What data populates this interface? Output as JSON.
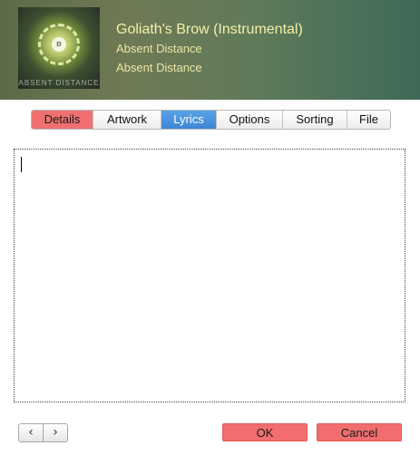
{
  "header": {
    "title": "Goliath's Brow (Instrumental)",
    "artist": "Absent Distance",
    "album": "Absent Distance",
    "artwork_text": "ABSENT DISTANCE"
  },
  "tabs": [
    {
      "label": "Details",
      "state": "highlighted"
    },
    {
      "label": "Artwork",
      "state": "normal"
    },
    {
      "label": "Lyrics",
      "state": "selected"
    },
    {
      "label": "Options",
      "state": "normal"
    },
    {
      "label": "Sorting",
      "state": "normal"
    },
    {
      "label": "File",
      "state": "normal"
    }
  ],
  "lyrics": {
    "value": ""
  },
  "nav": {
    "prev_icon": "chevron-left-icon",
    "next_icon": "chevron-right-icon",
    "prev_glyph": "‹",
    "next_glyph": "›"
  },
  "buttons": {
    "ok_label": "OK",
    "cancel_label": "Cancel"
  },
  "colors": {
    "accent_red": "#f26e6e",
    "selected_blue": "#3c86d4",
    "header_text": "#f4f0a8"
  }
}
